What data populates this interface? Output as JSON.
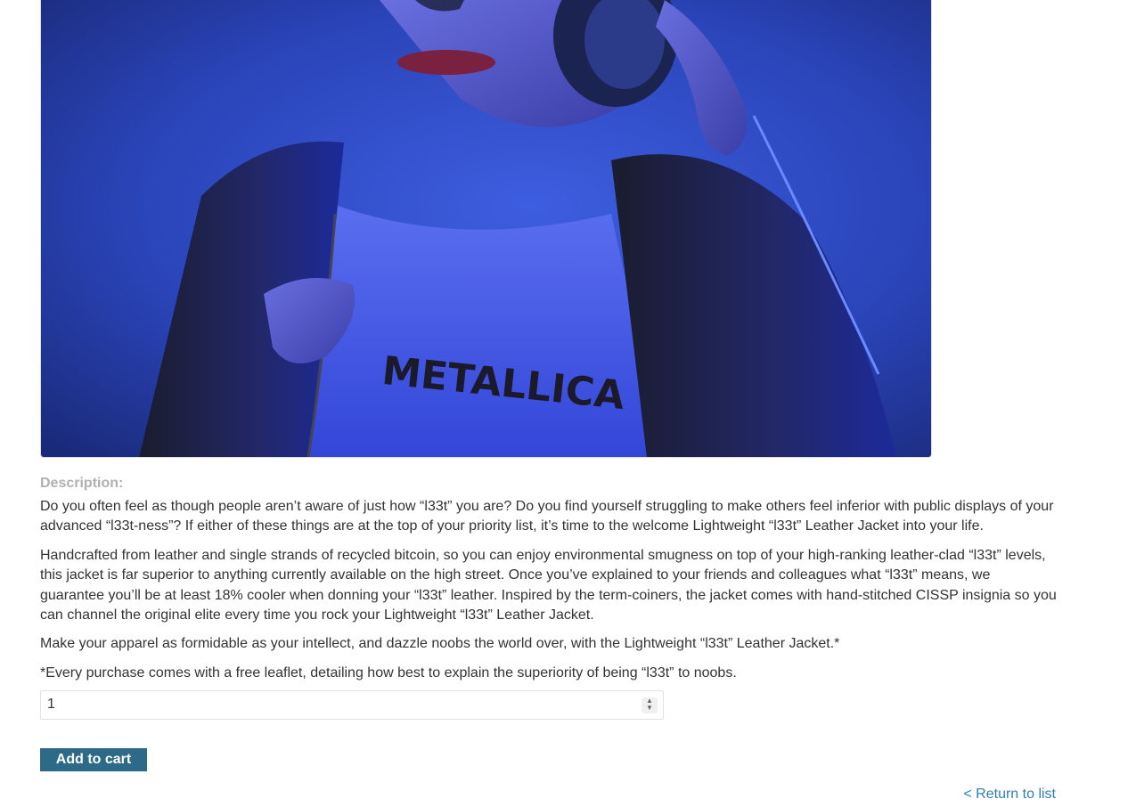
{
  "product": {
    "image_alt": "Person wearing headphones and a leather jacket",
    "shirt_print": "METALLICA"
  },
  "description": {
    "heading": "Description:",
    "paragraphs": [
      "Do you often feel as though people aren’t aware of just how “l33t” you are? Do you find yourself struggling to make others feel inferior with public displays of your advanced “l33t-ness”? If either of these things are at the top of your priority list, it’s time to the welcome Lightweight “l33t” Leather Jacket into your life.",
      "Handcrafted from leather and single strands of recycled bitcoin, so you can enjoy environmental smugness on top of your high-ranking leather-clad “l33t” levels, this jacket is far superior to anything currently available on the high street. Once you’ve explained to your friends and colleagues what “l33t” means, we guarantee you’ll be at least 18% cooler when donning your “l33t” leather. Inspired by the term-coiners, the jacket comes with hand-stitched CISSP insignia so you can channel the original elite every time you rock your Lightweight “l33t” Leather Jacket.",
      "Make your apparel as formidable as your intellect, and dazzle noobs the world over, with the Lightweight “l33t” Leather Jacket.*",
      "*Every purchase comes with a free leaflet, detailing how best to explain the superiority of being “l33t” to noobs."
    ]
  },
  "cart": {
    "quantity": "1",
    "add_label": "Add to cart"
  },
  "nav": {
    "return_label": "< Return to list"
  },
  "colors": {
    "button_bg": "#2d6a87",
    "link": "#2f7fb5",
    "heading": "#b0b0b0"
  }
}
